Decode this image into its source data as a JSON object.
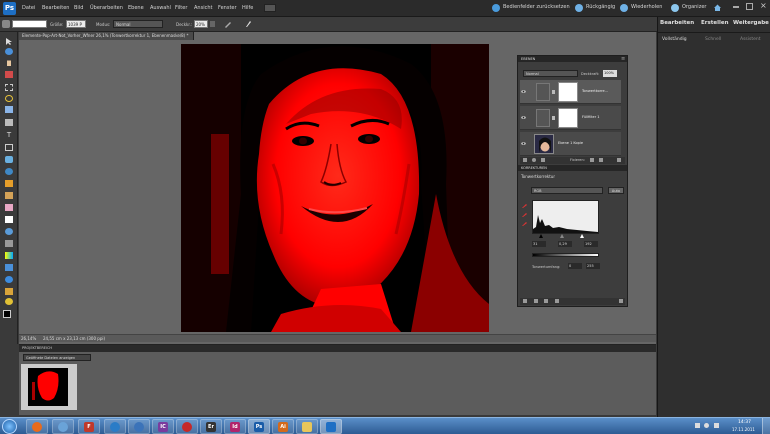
{
  "menubar": {
    "logo": "Ps",
    "items": [
      "Datei",
      "Bearbeiten",
      "Bild",
      "Überarbeiten",
      "Ebene",
      "Auswahl",
      "Filter",
      "Ansicht",
      "Fenster",
      "Hilfe"
    ],
    "reset": "Bedienfelder zurücksetzen",
    "undo": "Rückgängig",
    "redo": "Wiederholen",
    "organizer": "Organizer"
  },
  "options": {
    "size_label": "Größe:",
    "size_value": "1039 P",
    "mode_label": "Modus:",
    "mode_value": "Normal",
    "opacity_label": "Deckkr.:",
    "opacity_value": "20%"
  },
  "right_panel": {
    "tabs": [
      "Bearbeiten",
      "Erstellen",
      "Weitergabe"
    ],
    "subtabs": [
      "Vollständig",
      "Schnell",
      "Assistent"
    ]
  },
  "document": {
    "tab_title": "Elemente-Pop-Art-Not_Vorher_Wfner 26,1% (Tonwertkorrektur 1, Ebenenmaske/8) *",
    "zoom": "26,14%",
    "dimensions": "24,55 cm x 23,13 cm (300 ppi)"
  },
  "layers": {
    "title": "EBENEN",
    "blend": "Normal",
    "opacity_label": "Deckkraft:",
    "opacity_value": "100%",
    "items": [
      {
        "name": "Tonwertkorre..."
      },
      {
        "name": "Füllfilter 1"
      },
      {
        "name": "Ebene 1 Kopie"
      }
    ],
    "footer_label": "Fixieren:"
  },
  "adjust": {
    "title": "KORREKTUREN",
    "subtitle": "Tonwertkorrektur",
    "channel": "RGB",
    "auto": "Auto",
    "input_values": [
      "31",
      "0,29",
      "192"
    ],
    "output_label": "Tonwertumfang:",
    "output_values": [
      "0",
      "255"
    ]
  },
  "project": {
    "title": "PROJEKTBEREICH",
    "dropdown": "Geöffnete Dateien anzeigen"
  },
  "taskbar": {
    "clock_time": "14:37",
    "clock_date": "17.11.2011"
  },
  "colors": {
    "accent": "#1e6fc4",
    "image_red": "#ff0000",
    "panel_bg": "#3d3d3d"
  }
}
